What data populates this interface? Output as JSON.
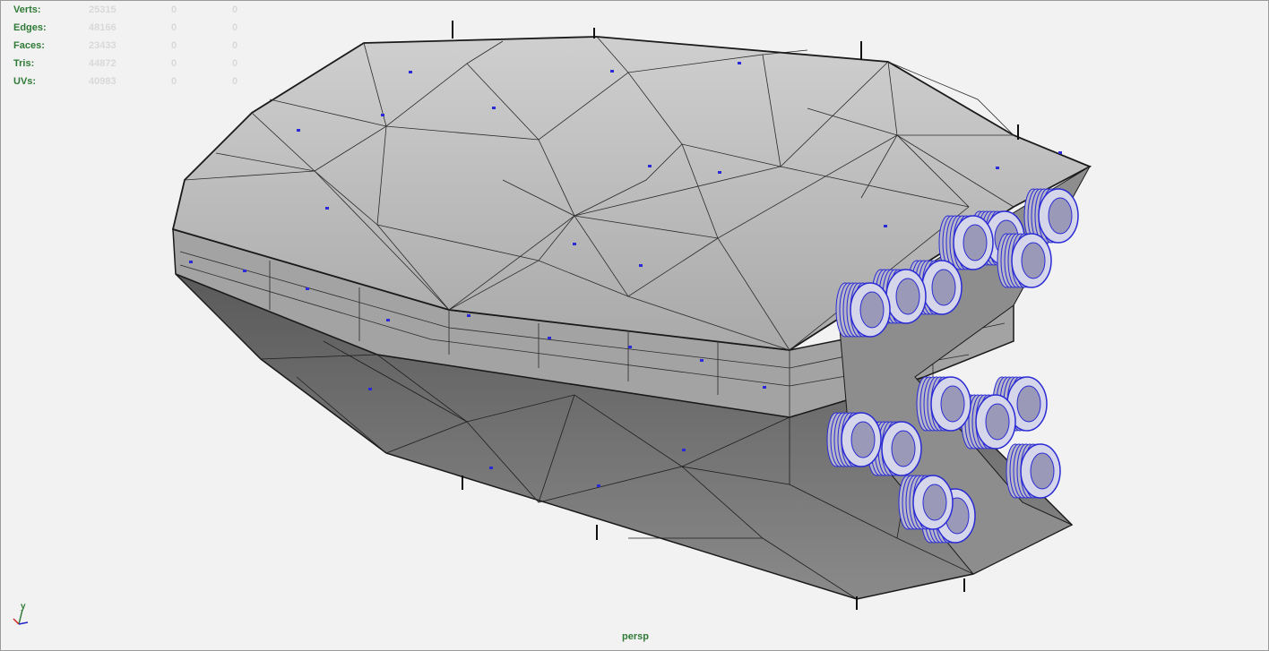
{
  "hud": {
    "rows": [
      {
        "label": "Verts:",
        "values": [
          "25315",
          "0",
          "0"
        ]
      },
      {
        "label": "Edges:",
        "values": [
          "48166",
          "0",
          "0"
        ]
      },
      {
        "label": "Faces:",
        "values": [
          "23433",
          "0",
          "0"
        ]
      },
      {
        "label": "Tris:",
        "values": [
          "44872",
          "0",
          "0"
        ]
      },
      {
        "label": "UVs:",
        "values": [
          "40983",
          "0",
          "0"
        ]
      }
    ]
  },
  "camera": "persp",
  "axis": {
    "up": "y"
  },
  "colors": {
    "hud_label": "#2f7a36",
    "hud_value": "#d9d9d9",
    "hull_top": "#bcbcbc",
    "hull_bottom": "#6b6b6b",
    "wire": "#1a1a1a",
    "highlight": "#2a2ad6"
  }
}
